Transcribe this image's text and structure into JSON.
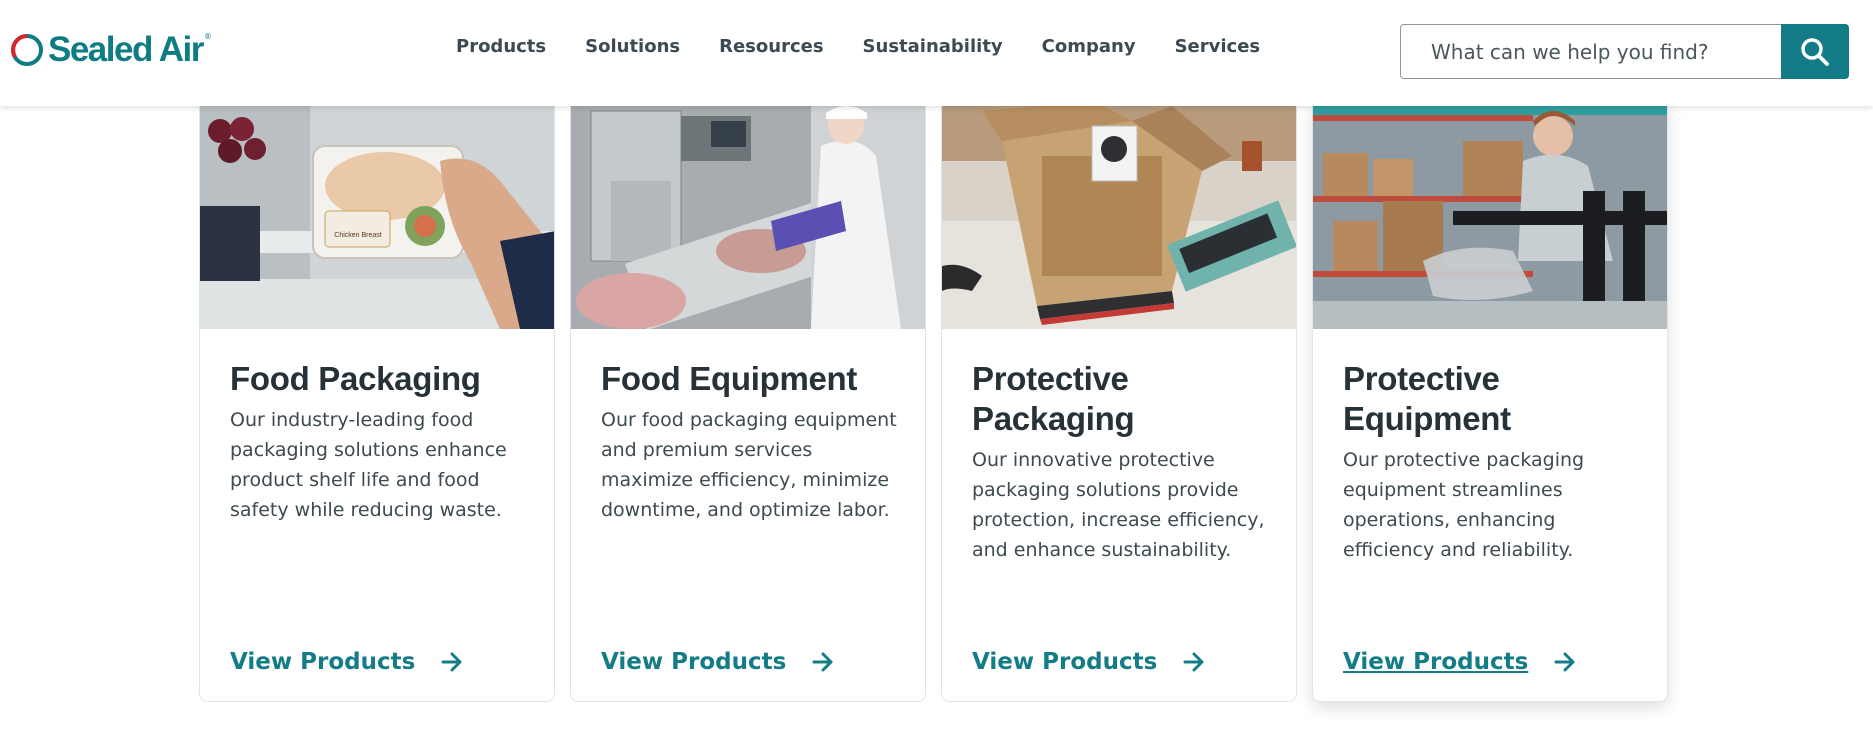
{
  "brand": {
    "name": "Sealed Air",
    "registered_mark": "®",
    "accent_color": "#137c87"
  },
  "nav": {
    "items": [
      {
        "label": "Products"
      },
      {
        "label": "Solutions"
      },
      {
        "label": "Resources"
      },
      {
        "label": "Sustainability"
      },
      {
        "label": "Company"
      },
      {
        "label": "Services"
      }
    ]
  },
  "search": {
    "placeholder": "What can we help you find?",
    "button_icon": "search-icon"
  },
  "cards": [
    {
      "title": "Food Packaging",
      "description": "Our industry-leading food packaging solutions enhance product shelf life and food safety while reducing waste.",
      "link_label": "View Products",
      "image_label": "Chicken Breast",
      "link_icon": "arrow-right-icon"
    },
    {
      "title": "Food Equipment",
      "description": "Our food packaging equipment and premium services maximize efficiency, minimize downtime, and optimize labor.",
      "link_label": "View Products",
      "link_icon": "arrow-right-icon"
    },
    {
      "title": "Protective Packaging",
      "description": "Our innovative protective packaging solutions provide protection, increase efficiency, and enhance sustainability.",
      "link_label": "View Products",
      "link_icon": "arrow-right-icon"
    },
    {
      "title": "Protective Equipment",
      "description": "Our protective packaging equipment streamlines operations, enhancing efficiency and reliability.",
      "link_label": "View Products",
      "link_icon": "arrow-right-icon",
      "hovered": true
    }
  ]
}
